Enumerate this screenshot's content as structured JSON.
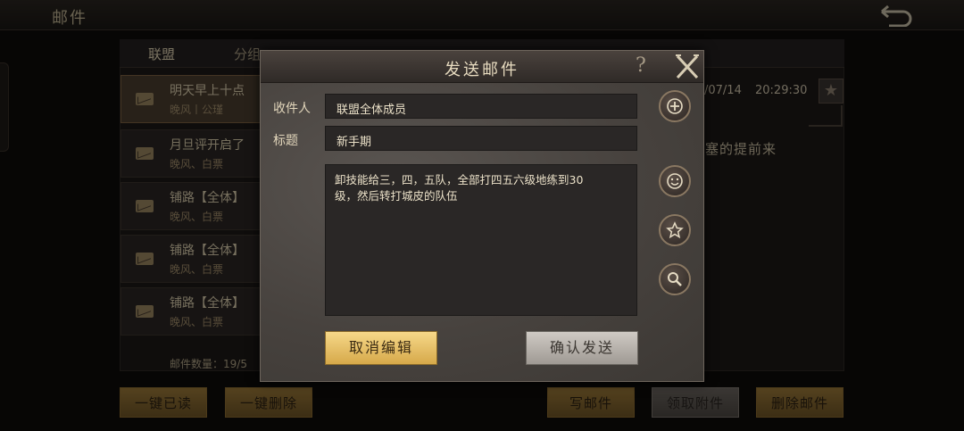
{
  "screen": {
    "title": "邮件",
    "tabs": [
      "联盟",
      "分组",
      "",
      ""
    ],
    "mails": [
      {
        "subject": "明天早上十点",
        "from": "晚风丨公瑾"
      },
      {
        "subject": "月旦评开启了",
        "from": "晚风、白票"
      },
      {
        "subject": "铺路【全体】",
        "from": "晚风、白票"
      },
      {
        "subject": "铺路【全体】",
        "from": "晚风、白票"
      },
      {
        "subject": "铺路【全体】",
        "from": "晚风、白票"
      }
    ],
    "mail_count": "邮件数量：19/5",
    "detail_date": "/07/14",
    "detail_time": "20:29:30",
    "detail_body_peek": "塞的提前来",
    "buttons": {
      "read_all": "一键已读",
      "delete_all": "一键删除",
      "write": "写邮件",
      "claim": "领取附件",
      "delete": "删除邮件"
    }
  },
  "dialog": {
    "title": "发送邮件",
    "recipient_label": "收件人",
    "recipient_value": "联盟全体成员",
    "subject_label": "标题",
    "subject_value": "新手期",
    "body_line1": "卸技能给三，四，五队，全部打四五六级地练到30",
    "body_line2": "级，然后转打城皮的队伍",
    "cancel_label": "取消编辑",
    "confirm_label": "确认发送",
    "icons": [
      "help-icon",
      "close-icon",
      "add-icon",
      "smiley-icon",
      "star-icon",
      "search-icon"
    ]
  },
  "colors": {
    "gold_button": "#e6c068",
    "grey_button": "#b8b3ad",
    "dialog_bg": "#4a4541"
  }
}
